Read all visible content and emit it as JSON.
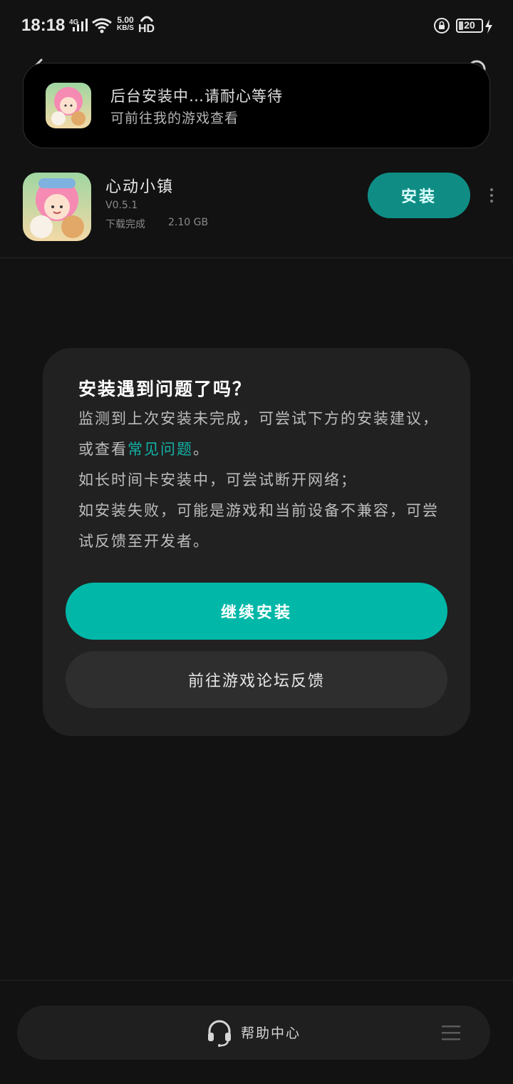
{
  "status_bar": {
    "time": "18:18",
    "network": "4G",
    "speed_value": "5.00",
    "speed_unit": "KB/S",
    "hd": "HD",
    "battery": "20"
  },
  "toast": {
    "line1": "后台安装中…请耐心等待",
    "line2": "可前往我的游戏查看",
    "icon": "game-icon-heart-town"
  },
  "app": {
    "name": "心动小镇",
    "version": "V0.5.1",
    "status": "下载完成",
    "size": "2.10 GB",
    "install_label": "安装",
    "icon": "game-icon-heart-town"
  },
  "dialog": {
    "title": "安装遇到问题了吗？",
    "body_line1_prefix": "监测到上次安装未完成，可尝试下方的安装建议，或查看",
    "faq_link": "常见问题",
    "body_line1_suffix": "。",
    "body_line2": "如长时间卡安装中，可尝试断开网络；",
    "body_line3": "如安装失败，可能是游戏和当前设备不兼容，可尝试反馈至开发者。",
    "continue_label": "继续安装",
    "forum_label": "前往游戏论坛反馈"
  },
  "bottom_bar": {
    "help_label": "帮助中心",
    "icons": [
      "headset-icon",
      "menu-icon"
    ]
  },
  "colors": {
    "background": "#121212",
    "accent": "#01b8a8",
    "dialog_bg": "#212121",
    "link": "#12b3a6"
  }
}
